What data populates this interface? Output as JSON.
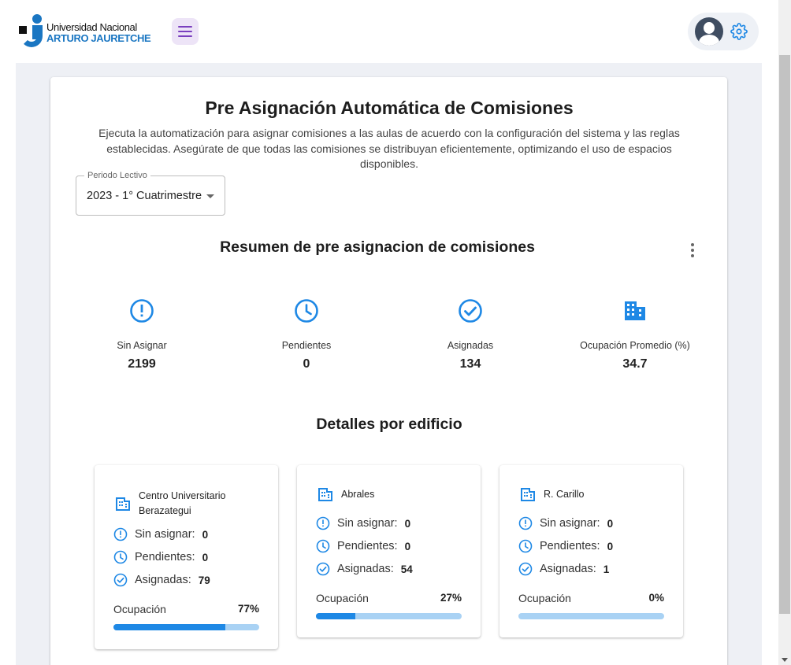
{
  "header": {
    "logo_line1": "Universidad Nacional",
    "logo_line2": "ARTURO JAURETCHE"
  },
  "page": {
    "title": "Pre Asignación Automática de Comisiones",
    "description": "Ejecuta la automatización para asignar comisiones a las aulas de acuerdo con la configuración del sistema y las reglas establecidas. Asegúrate de que todas las comisiones se distribuyan eficientemente, optimizando el uso de espacios disponibles.",
    "period": {
      "label": "Periodo Lectivo",
      "value": "2023 - 1° Cuatrimestre"
    }
  },
  "summary": {
    "title": "Resumen de pre asignacion de comisiones",
    "stats": [
      {
        "label": "Sin Asignar",
        "value": "2199",
        "icon": "exclamation-icon"
      },
      {
        "label": "Pendientes",
        "value": "0",
        "icon": "clock-icon"
      },
      {
        "label": "Asignadas",
        "value": "134",
        "icon": "check-circle-icon"
      },
      {
        "label": "Ocupación Promedio (%)",
        "value": "34.7",
        "icon": "building-icon"
      }
    ]
  },
  "details": {
    "title": "Detalles por edificio",
    "labels": {
      "sin_asignar": "Sin asignar:",
      "pendientes": "Pendientes:",
      "asignadas": "Asignadas:",
      "ocupacion": "Ocupación"
    },
    "buildings": [
      {
        "name_line1": "Centro Universitario",
        "name_line2": "Berazategui",
        "sin_asignar": "0",
        "pendientes": "0",
        "asignadas": "79",
        "ocupacion": "77%",
        "ocupacion_fraction": 0.77
      },
      {
        "name_line1": "Abrales",
        "name_line2": "",
        "sin_asignar": "0",
        "pendientes": "0",
        "asignadas": "54",
        "ocupacion": "27%",
        "ocupacion_fraction": 0.27
      },
      {
        "name_line1": "R. Carillo",
        "name_line2": "",
        "sin_asignar": "0",
        "pendientes": "0",
        "asignadas": "1",
        "ocupacion": "0%",
        "ocupacion_fraction": 0.0
      }
    ]
  },
  "colors": {
    "accent": "#1e88e5",
    "bar_track": "#a9d2f4",
    "menu_bg": "#ede4f7",
    "menu_icon": "#7a3fbf",
    "page_bg": "#eef0f5"
  }
}
